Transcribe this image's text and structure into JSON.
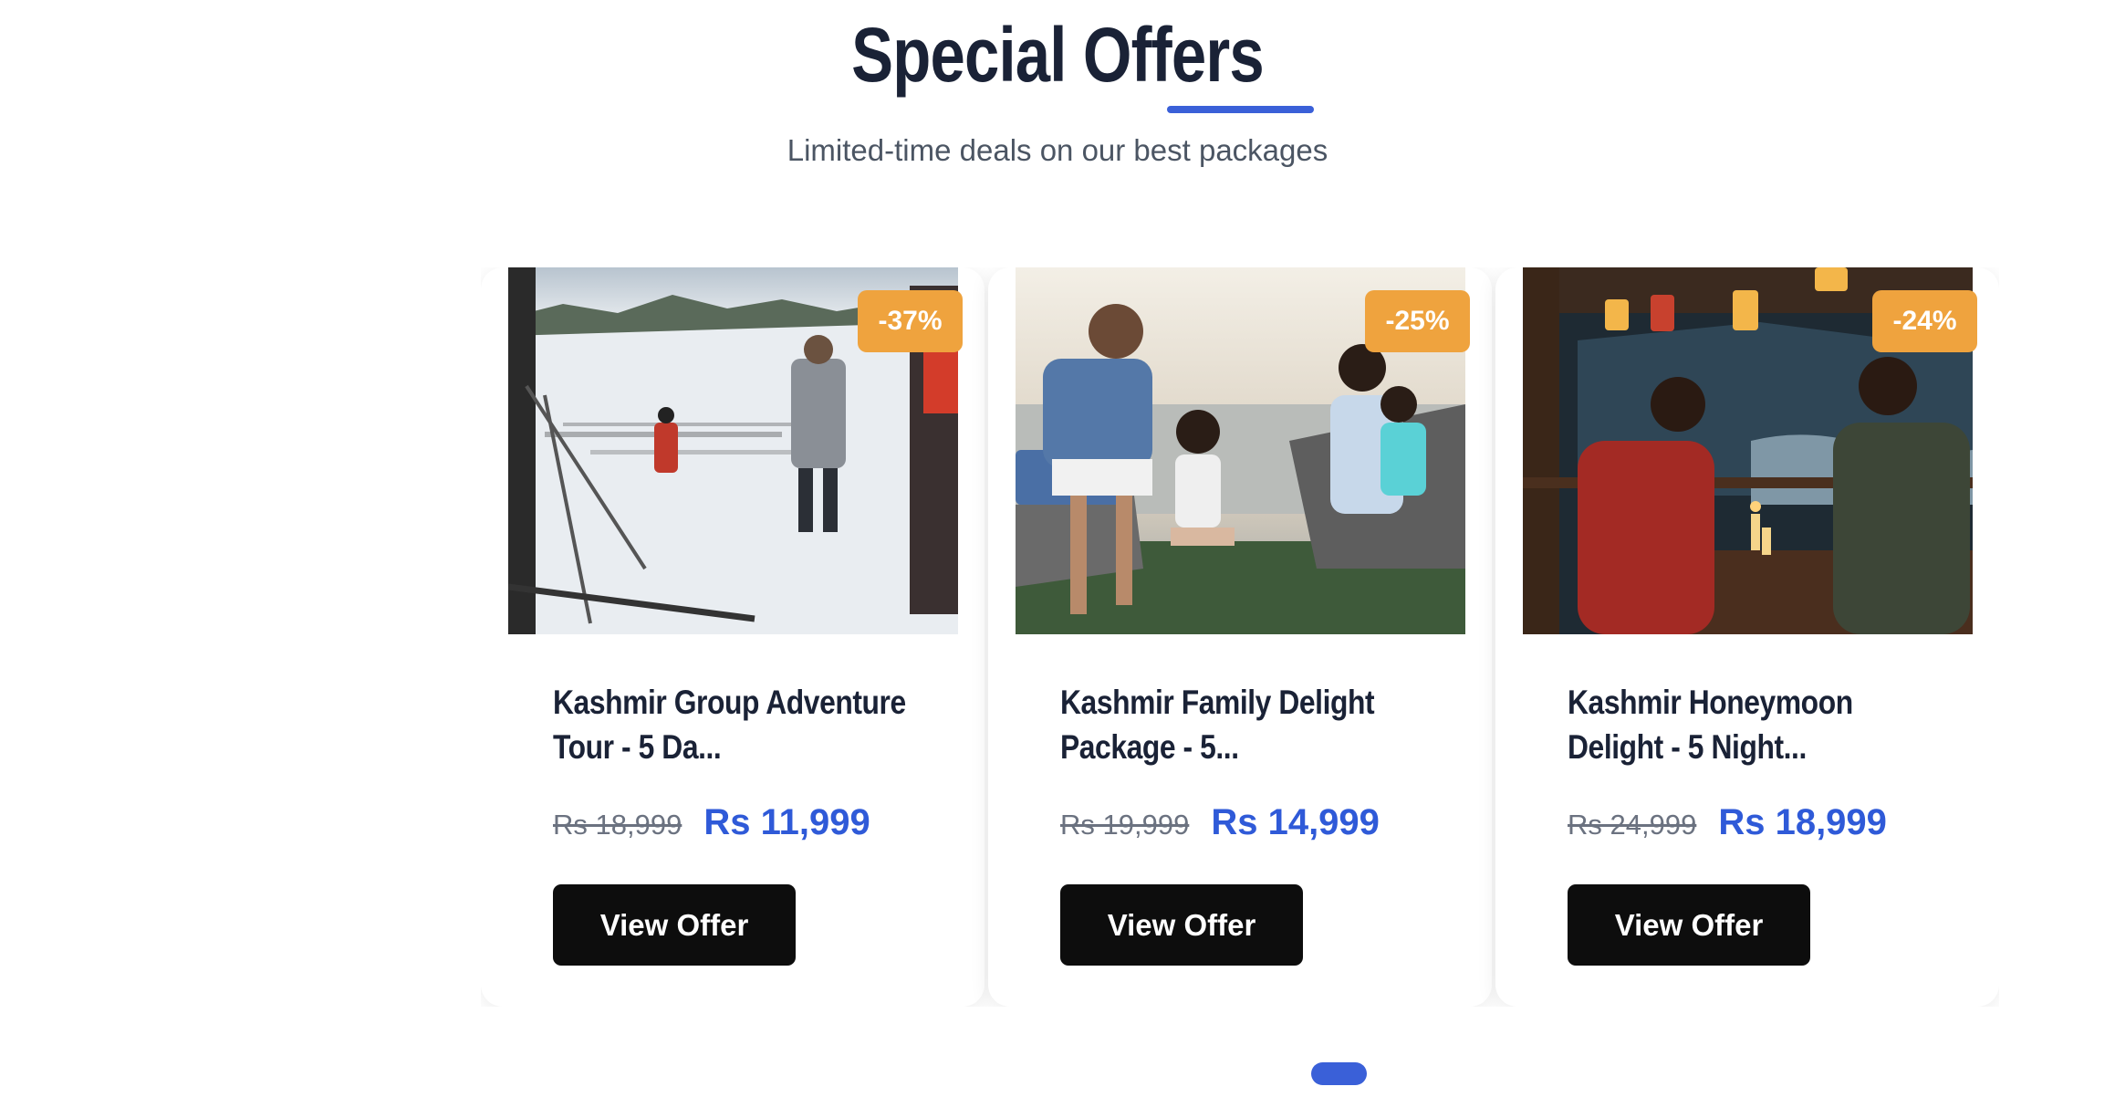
{
  "section": {
    "title": "Special Offers",
    "subtitle": "Limited-time deals on our best packages"
  },
  "offers": [
    {
      "image_icon": "snow-ski-photo",
      "discount": "-37%",
      "title": "Kashmir Group Adventure Tour - 5 Da...",
      "old_price": "Rs 18,999",
      "new_price": "Rs 11,999",
      "button_label": "View Offer"
    },
    {
      "image_icon": "family-boat-photo",
      "discount": "-25%",
      "title": "Kashmir Family Delight Package - 5...",
      "old_price": "Rs 19,999",
      "new_price": "Rs 14,999",
      "button_label": "View Offer"
    },
    {
      "image_icon": "honeymoon-dinner-photo",
      "discount": "-24%",
      "title": "Kashmir Honeymoon Delight - 5 Night...",
      "old_price": "Rs 24,999",
      "new_price": "Rs 18,999",
      "button_label": "View Offer"
    }
  ],
  "carousel": {
    "active_page": 1,
    "page_count": 1
  },
  "colors": {
    "accent": "#3a60d8",
    "badge": "#efa33e",
    "heading": "#1a2236",
    "button": "#0d0d0d"
  }
}
